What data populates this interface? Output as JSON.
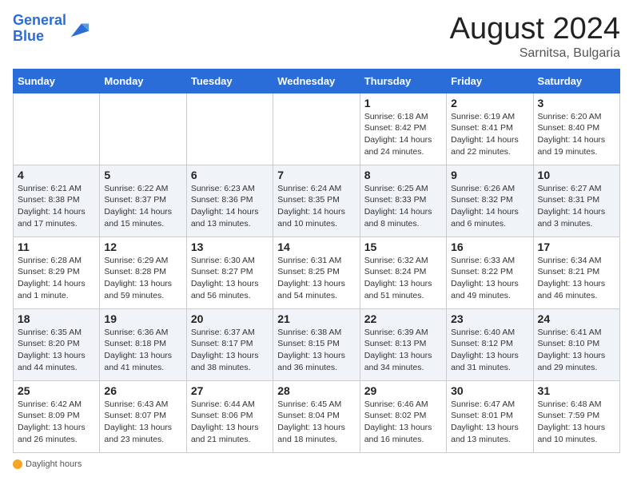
{
  "logo": {
    "line1": "General",
    "line2": "Blue"
  },
  "title": "August 2024",
  "subtitle": "Sarnitsa, Bulgaria",
  "days_of_week": [
    "Sunday",
    "Monday",
    "Tuesday",
    "Wednesday",
    "Thursday",
    "Friday",
    "Saturday"
  ],
  "weeks": [
    [
      {
        "day": "",
        "info": ""
      },
      {
        "day": "",
        "info": ""
      },
      {
        "day": "",
        "info": ""
      },
      {
        "day": "",
        "info": ""
      },
      {
        "day": "1",
        "info": "Sunrise: 6:18 AM\nSunset: 8:42 PM\nDaylight: 14 hours and 24 minutes."
      },
      {
        "day": "2",
        "info": "Sunrise: 6:19 AM\nSunset: 8:41 PM\nDaylight: 14 hours and 22 minutes."
      },
      {
        "day": "3",
        "info": "Sunrise: 6:20 AM\nSunset: 8:40 PM\nDaylight: 14 hours and 19 minutes."
      }
    ],
    [
      {
        "day": "4",
        "info": "Sunrise: 6:21 AM\nSunset: 8:38 PM\nDaylight: 14 hours and 17 minutes."
      },
      {
        "day": "5",
        "info": "Sunrise: 6:22 AM\nSunset: 8:37 PM\nDaylight: 14 hours and 15 minutes."
      },
      {
        "day": "6",
        "info": "Sunrise: 6:23 AM\nSunset: 8:36 PM\nDaylight: 14 hours and 13 minutes."
      },
      {
        "day": "7",
        "info": "Sunrise: 6:24 AM\nSunset: 8:35 PM\nDaylight: 14 hours and 10 minutes."
      },
      {
        "day": "8",
        "info": "Sunrise: 6:25 AM\nSunset: 8:33 PM\nDaylight: 14 hours and 8 minutes."
      },
      {
        "day": "9",
        "info": "Sunrise: 6:26 AM\nSunset: 8:32 PM\nDaylight: 14 hours and 6 minutes."
      },
      {
        "day": "10",
        "info": "Sunrise: 6:27 AM\nSunset: 8:31 PM\nDaylight: 14 hours and 3 minutes."
      }
    ],
    [
      {
        "day": "11",
        "info": "Sunrise: 6:28 AM\nSunset: 8:29 PM\nDaylight: 14 hours and 1 minute."
      },
      {
        "day": "12",
        "info": "Sunrise: 6:29 AM\nSunset: 8:28 PM\nDaylight: 13 hours and 59 minutes."
      },
      {
        "day": "13",
        "info": "Sunrise: 6:30 AM\nSunset: 8:27 PM\nDaylight: 13 hours and 56 minutes."
      },
      {
        "day": "14",
        "info": "Sunrise: 6:31 AM\nSunset: 8:25 PM\nDaylight: 13 hours and 54 minutes."
      },
      {
        "day": "15",
        "info": "Sunrise: 6:32 AM\nSunset: 8:24 PM\nDaylight: 13 hours and 51 minutes."
      },
      {
        "day": "16",
        "info": "Sunrise: 6:33 AM\nSunset: 8:22 PM\nDaylight: 13 hours and 49 minutes."
      },
      {
        "day": "17",
        "info": "Sunrise: 6:34 AM\nSunset: 8:21 PM\nDaylight: 13 hours and 46 minutes."
      }
    ],
    [
      {
        "day": "18",
        "info": "Sunrise: 6:35 AM\nSunset: 8:20 PM\nDaylight: 13 hours and 44 minutes."
      },
      {
        "day": "19",
        "info": "Sunrise: 6:36 AM\nSunset: 8:18 PM\nDaylight: 13 hours and 41 minutes."
      },
      {
        "day": "20",
        "info": "Sunrise: 6:37 AM\nSunset: 8:17 PM\nDaylight: 13 hours and 38 minutes."
      },
      {
        "day": "21",
        "info": "Sunrise: 6:38 AM\nSunset: 8:15 PM\nDaylight: 13 hours and 36 minutes."
      },
      {
        "day": "22",
        "info": "Sunrise: 6:39 AM\nSunset: 8:13 PM\nDaylight: 13 hours and 34 minutes."
      },
      {
        "day": "23",
        "info": "Sunrise: 6:40 AM\nSunset: 8:12 PM\nDaylight: 13 hours and 31 minutes."
      },
      {
        "day": "24",
        "info": "Sunrise: 6:41 AM\nSunset: 8:10 PM\nDaylight: 13 hours and 29 minutes."
      }
    ],
    [
      {
        "day": "25",
        "info": "Sunrise: 6:42 AM\nSunset: 8:09 PM\nDaylight: 13 hours and 26 minutes."
      },
      {
        "day": "26",
        "info": "Sunrise: 6:43 AM\nSunset: 8:07 PM\nDaylight: 13 hours and 23 minutes."
      },
      {
        "day": "27",
        "info": "Sunrise: 6:44 AM\nSunset: 8:06 PM\nDaylight: 13 hours and 21 minutes."
      },
      {
        "day": "28",
        "info": "Sunrise: 6:45 AM\nSunset: 8:04 PM\nDaylight: 13 hours and 18 minutes."
      },
      {
        "day": "29",
        "info": "Sunrise: 6:46 AM\nSunset: 8:02 PM\nDaylight: 13 hours and 16 minutes."
      },
      {
        "day": "30",
        "info": "Sunrise: 6:47 AM\nSunset: 8:01 PM\nDaylight: 13 hours and 13 minutes."
      },
      {
        "day": "31",
        "info": "Sunrise: 6:48 AM\nSunset: 7:59 PM\nDaylight: 13 hours and 10 minutes."
      }
    ]
  ],
  "footer": {
    "daylight_label": "Daylight hours"
  }
}
